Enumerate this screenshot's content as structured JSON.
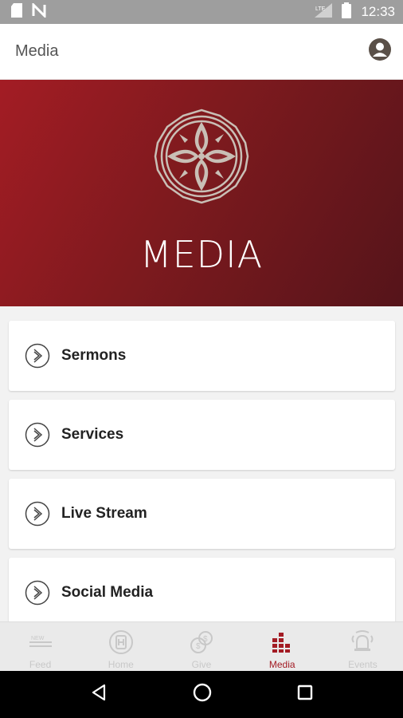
{
  "status_bar": {
    "time": "12:33",
    "icons": [
      "sd-card-icon",
      "no-signal-icon",
      "cellular-lte-icon",
      "battery-icon"
    ]
  },
  "app_bar": {
    "title": "Media",
    "account_icon": "account-circle-icon"
  },
  "hero": {
    "title": "MEDIA",
    "logo_icon": "ornamental-medallion-logo"
  },
  "menu": {
    "items": [
      {
        "label": "Sermons",
        "icon": "chevron-circle-icon"
      },
      {
        "label": "Services",
        "icon": "chevron-circle-icon"
      },
      {
        "label": "Live Stream",
        "icon": "chevron-circle-icon"
      },
      {
        "label": "Social Media",
        "icon": "chevron-circle-icon"
      }
    ]
  },
  "bottom_nav": {
    "items": [
      {
        "label": "Feed",
        "icon": "new-feed-icon",
        "active": false
      },
      {
        "label": "Home",
        "icon": "home-circle-icon",
        "active": false
      },
      {
        "label": "Give",
        "icon": "coins-icon",
        "active": false
      },
      {
        "label": "Media",
        "icon": "media-bars-icon",
        "active": true
      },
      {
        "label": "Events",
        "icon": "bell-icon",
        "active": false
      }
    ],
    "active_color": "#a31c24",
    "inactive_color": "#c8c8c8"
  },
  "colors": {
    "hero_start": "#a31c24",
    "hero_end": "#55141a",
    "status_bar": "#9e9e9e"
  }
}
